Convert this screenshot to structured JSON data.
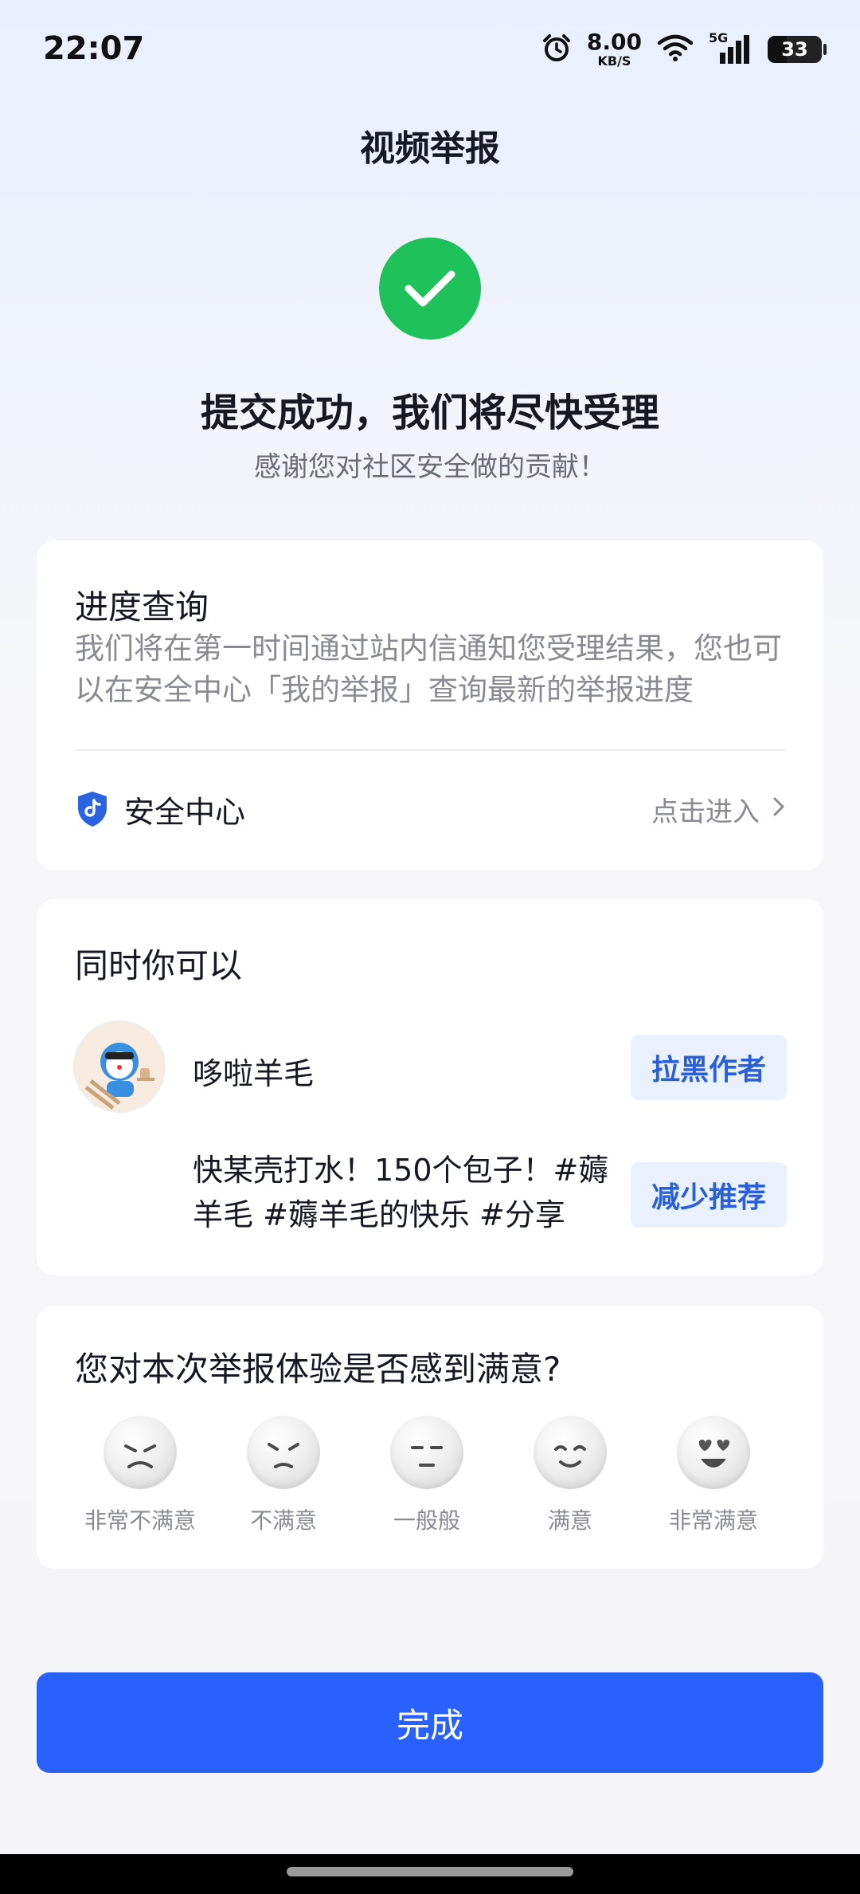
{
  "status_bar": {
    "time": "22:07",
    "network_speed": "8.00",
    "speed_unit": "KB/S",
    "network_type": "5G",
    "battery": "33"
  },
  "header": {
    "title": "视频举报"
  },
  "success": {
    "headline": "提交成功，我们将尽快受理",
    "subline": "感谢您对社区安全做的贡献！",
    "icon_color": "#1fc15a"
  },
  "progress_card": {
    "title": "进度查询",
    "description": "我们将在第一时间通过站内信通知您受理结果，您也可以在安全中心「我的举报」查询最新的举报进度",
    "safety_center_label": "安全中心",
    "enter_label": "点击进入"
  },
  "actions_card": {
    "title": "同时你可以",
    "author_name": "哆啦羊毛",
    "block_button": "拉黑作者",
    "video_description": "快某壳打水！150个包子！#薅羊毛 #薅羊毛的快乐 #分享",
    "reduce_button": "减少推荐"
  },
  "rating_card": {
    "question": "您对本次举报体验是否感到满意?",
    "options": [
      {
        "label": "非常不满意",
        "icon": "very-dissatisfied-face-icon"
      },
      {
        "label": "不满意",
        "icon": "dissatisfied-face-icon"
      },
      {
        "label": "一般般",
        "icon": "neutral-face-icon"
      },
      {
        "label": "满意",
        "icon": "satisfied-face-icon"
      },
      {
        "label": "非常满意",
        "icon": "very-satisfied-face-icon"
      }
    ]
  },
  "footer": {
    "done_button": "完成",
    "accent_color": "#2861ff"
  }
}
